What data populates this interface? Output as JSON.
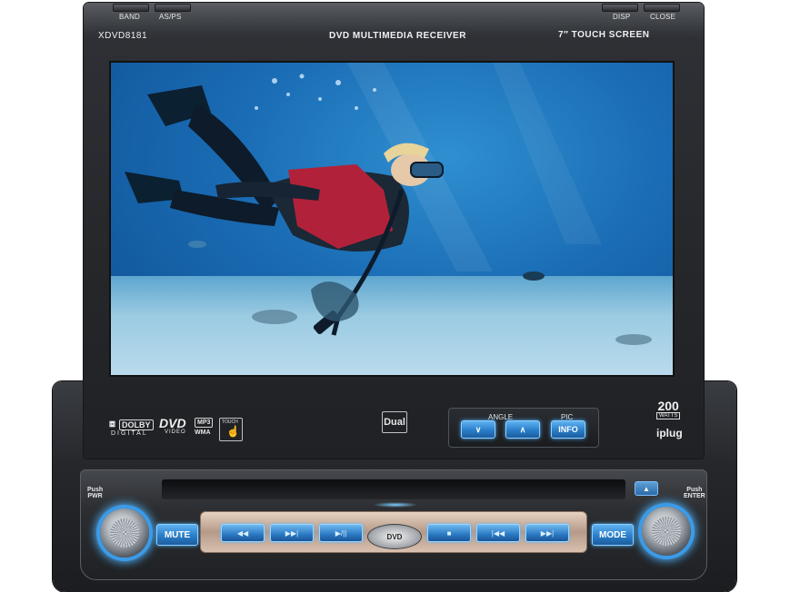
{
  "monitor": {
    "model": "XDVD8181",
    "title": "DVD MULTIMEDIA RECEIVER",
    "screen_size": "7",
    "screen_label": "TOUCH SCREEN",
    "top_left_buttons": [
      "BAND",
      "AS/PS"
    ],
    "top_right_buttons": [
      "DISP",
      "CLOSE"
    ],
    "brand": "Dual",
    "badges": {
      "dolby": "DOLBY",
      "digital": "DIGITAL",
      "dvd": "DVD",
      "dvd_sub": "VIDEO",
      "mp3": "MP3",
      "wma": "WMA",
      "touch": "TOUCH"
    },
    "controls": {
      "angle_label": "ANGLE",
      "pic_label": "PIC",
      "info_label": "INFO",
      "down_symbol": "∨",
      "up_symbol": "∧"
    },
    "watts_value": "200",
    "watts_unit": "WATTS",
    "plug_label": "iplug"
  },
  "base": {
    "push_left": "Push",
    "pwr": "PWR",
    "push_right": "Push",
    "enter": "ENTER",
    "mute": "MUTE",
    "mode": "MODE",
    "dvd_logo": "DVD",
    "eject": "▲",
    "transport": [
      "◀◀",
      "▶▶|",
      "▶/||",
      "■",
      "|◀◀",
      "▶▶|"
    ]
  },
  "colors": {
    "accent_blue": "#2a7ec8",
    "glow_blue": "#4fb4ff",
    "housing": "#26282c"
  }
}
